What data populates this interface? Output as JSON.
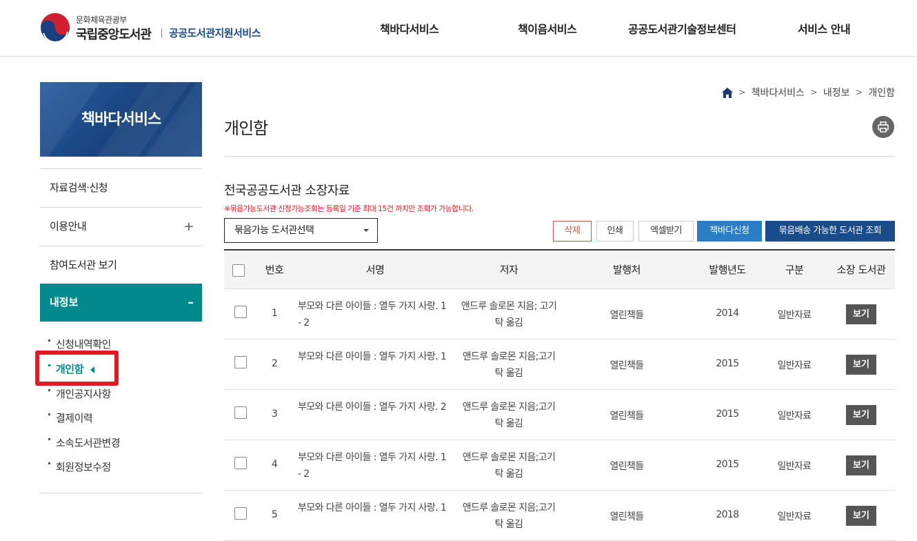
{
  "header": {
    "ministry": "문화체육관광부",
    "library": "국립중앙도서관",
    "service": "공공도서관지원서비스",
    "nav": [
      "책바다서비스",
      "책이음서비스",
      "공공도서관기술정보센터",
      "서비스 안내"
    ]
  },
  "lnb": {
    "title": "책바다서비스",
    "items": [
      {
        "label": "자료검색·신청",
        "sign": ""
      },
      {
        "label": "이용안내",
        "sign": "+"
      },
      {
        "label": "참여도서관 보기",
        "sign": ""
      }
    ],
    "active": {
      "label": "내정보",
      "sign": "–"
    },
    "subitems": [
      "신청내역확인",
      "개인함",
      "개인공지사항",
      "결제이력",
      "소속도서관변경",
      "회원정보수정"
    ]
  },
  "breadcrumb": [
    "책바다서비스",
    "내정보",
    "개인함"
  ],
  "page_title": "개인함",
  "section": {
    "title": "전국공공도서관 소장자료",
    "notice": "※묶음가능도서관 신청가능조회는 등록일 기준 최대 15건 까지만 조회가 가능합니다.",
    "select_label": "묶음가능 도서관선택"
  },
  "buttons": {
    "delete": "삭제",
    "print": "인쇄",
    "excel": "엑셀받기",
    "request": "책바다신청",
    "bundle": "묶음배송 가능한 도서관 조회"
  },
  "table": {
    "headers": [
      "번호",
      "서명",
      "저자",
      "발행처",
      "발행년도",
      "구분",
      "소장 도서관"
    ],
    "rows": [
      {
        "no": "1",
        "title1": "부모와 다른 아이들 : 열두 가지 사랑. 1",
        "title2": "- 2",
        "author1": "앤드루 솔로몬 지음; 고기",
        "author2": "탁 옮김",
        "publisher": "열린책들",
        "year": "2014",
        "type": "일반자료",
        "view": "보기"
      },
      {
        "no": "2",
        "title1": "부모와 다른 아이들 : 열두 가지 사랑. 1",
        "title2": "",
        "author1": "앤드루 솔로몬 지음;고기",
        "author2": "탁 옮김",
        "publisher": "열린책들",
        "year": "2015",
        "type": "일반자료",
        "view": "보기"
      },
      {
        "no": "3",
        "title1": "부모와 다른 아이들 : 열두 가지 사랑. 2",
        "title2": "",
        "author1": "앤드루 솔로몬 지음;고기",
        "author2": "탁 옮김",
        "publisher": "열린책들",
        "year": "2015",
        "type": "일반자료",
        "view": "보기"
      },
      {
        "no": "4",
        "title1": "부모와 다른 아이들 : 열두 가지 사랑. 1",
        "title2": "- 2",
        "author1": "앤드루 솔로몬 지음;고기",
        "author2": "탁 옮김",
        "publisher": "열린책들",
        "year": "2015",
        "type": "일반자료",
        "view": "보기"
      },
      {
        "no": "5",
        "title1": "부모와 다른 아이들 : 열두 가지 사랑. 1",
        "title2": "",
        "author1": "앤드루 솔로몬 지음;고기",
        "author2": "탁 옮김",
        "publisher": "열린책들",
        "year": "2018",
        "type": "일반자료",
        "view": "보기"
      }
    ]
  },
  "colors": {
    "accent": "#008a8e",
    "brand": "#1a4c8b",
    "highlight": "#e11b22"
  }
}
